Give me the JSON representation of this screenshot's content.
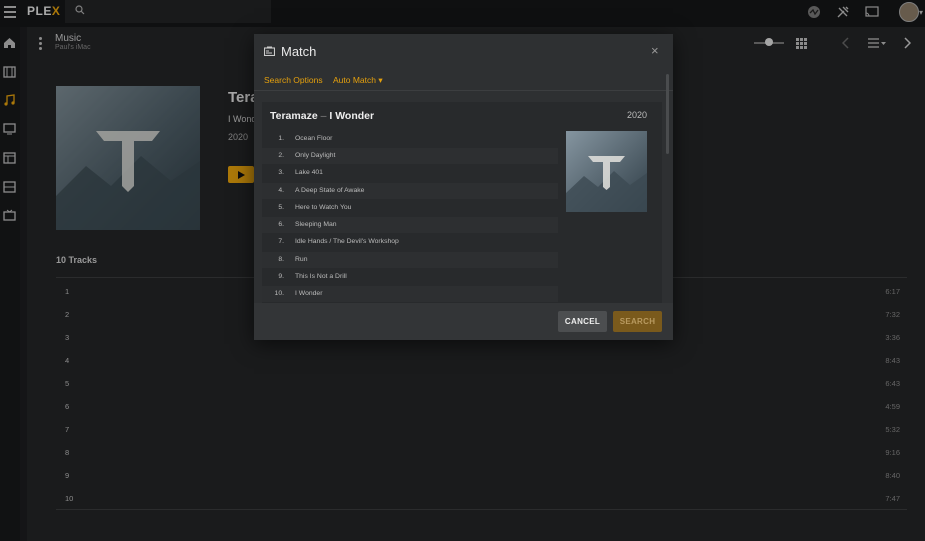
{
  "topbar": {
    "logo_main": "PLE",
    "logo_accent": "X"
  },
  "library": {
    "title": "Music",
    "subtitle": "Paul's iMac"
  },
  "album": {
    "title": "Teramaze",
    "subtitle": "I Wonder",
    "year": "2020"
  },
  "tracks": {
    "heading": "10 Tracks",
    "rows": [
      {
        "num": "1",
        "duration": "6:17"
      },
      {
        "num": "2",
        "duration": "7:32"
      },
      {
        "num": "3",
        "duration": "3:36"
      },
      {
        "num": "4",
        "duration": "8:43"
      },
      {
        "num": "5",
        "duration": "6:43"
      },
      {
        "num": "6",
        "duration": "4:59"
      },
      {
        "num": "7",
        "duration": "5:32"
      },
      {
        "num": "8",
        "duration": "9:16"
      },
      {
        "num": "9",
        "duration": "8:40"
      },
      {
        "num": "10",
        "duration": "7:47"
      }
    ]
  },
  "modal": {
    "title": "Match",
    "close": "×",
    "tabs": {
      "search_options": "Search Options",
      "auto_match": "Auto Match ▾"
    },
    "result": {
      "artist": "Teramaze",
      "separator": "–",
      "album": "I Wonder",
      "year": "2020",
      "tracks": [
        {
          "num": "1.",
          "title": "Ocean Floor"
        },
        {
          "num": "2.",
          "title": "Only Daylight"
        },
        {
          "num": "3.",
          "title": "Lake 401"
        },
        {
          "num": "4.",
          "title": "A Deep State of Awake"
        },
        {
          "num": "5.",
          "title": "Here to Watch You"
        },
        {
          "num": "6.",
          "title": "Sleeping Man"
        },
        {
          "num": "7.",
          "title": "Idle Hands / The Devil's Workshop"
        },
        {
          "num": "8.",
          "title": "Run"
        },
        {
          "num": "9.",
          "title": "This Is Not a Drill"
        },
        {
          "num": "10.",
          "title": "I Wonder"
        }
      ]
    },
    "buttons": {
      "cancel": "CANCEL",
      "search": "SEARCH"
    }
  },
  "colors": {
    "accent": "#e5a00d",
    "modal_bg": "#2e3032",
    "page_bg": "#1c1d1f"
  }
}
